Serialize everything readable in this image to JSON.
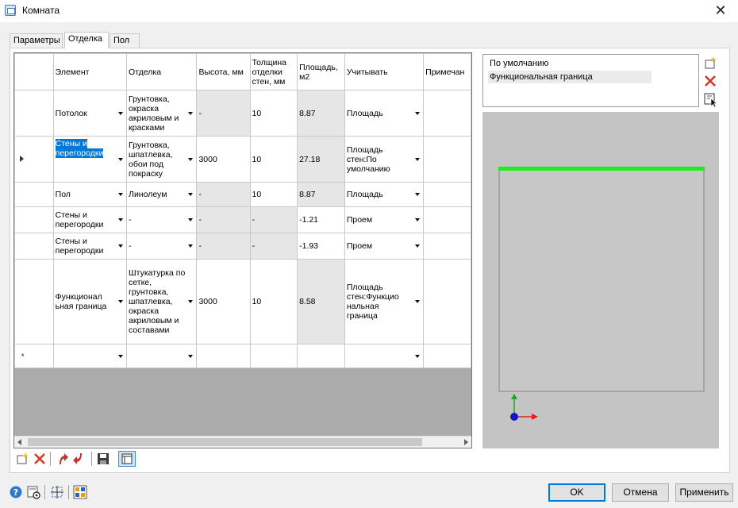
{
  "window": {
    "title": "Комната",
    "close_glyph": "✕"
  },
  "tabs": [
    {
      "label": "Параметры",
      "active": false
    },
    {
      "label": "Отделка",
      "active": true
    },
    {
      "label": "Пол",
      "active": false
    }
  ],
  "table": {
    "headers": {
      "element": "Элемент",
      "finish": "Отделка",
      "height": "Высота, мм",
      "thickness": "Толщина отделки стен, мм",
      "area": "Площадь, м2",
      "consider": "Учитывать",
      "note": "Примечан"
    },
    "rows": [
      {
        "element": "Потолок",
        "finish": "Грунтовка, окраска акриловым и красками",
        "height": "-",
        "thickness": "10",
        "area": "8.87",
        "consider": "Площадь"
      },
      {
        "element": "Стены и перегородки",
        "finish": "Грунтовка, шпатлевка, обои под покраску",
        "height": "3000",
        "thickness": "10",
        "area": "27.18",
        "consider": "Площадь стен:По умолчанию"
      },
      {
        "element": "Пол",
        "finish": "Линолеум",
        "height": "-",
        "thickness": "10",
        "area": "8.87",
        "consider": "Площадь"
      },
      {
        "element": "Стены и перегородки",
        "finish": "-",
        "height": "-",
        "thickness": "-",
        "area": "-1.21",
        "consider": "Проем"
      },
      {
        "element": "Стены и перегородки",
        "finish": "-",
        "height": "-",
        "thickness": "-",
        "area": "-1.93",
        "consider": "Проем"
      },
      {
        "element": "Функционал ьная граница",
        "finish": "Штукатурка по сетке, грунтовка, шпатлевка, окраска акриловым и составами",
        "height": "3000",
        "thickness": "10",
        "area": "8.58",
        "consider": "Площадь стен:Функцио нальная граница"
      }
    ],
    "new_row_marker": "*"
  },
  "contours": {
    "items": [
      {
        "label": "По умолчанию"
      },
      {
        "label": "Функциональная граница"
      }
    ]
  },
  "buttons": {
    "ok": "OK",
    "cancel": "Отмена",
    "apply": "Применить"
  },
  "colors": {
    "selection": "#0078d7",
    "boundary": "#22e822",
    "delete": "#d33a2c"
  }
}
